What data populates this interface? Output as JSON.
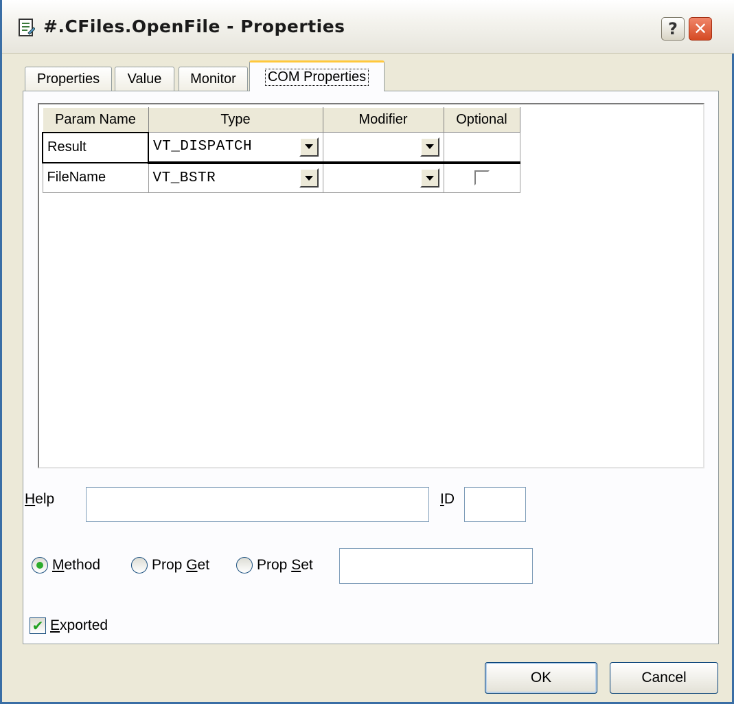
{
  "window": {
    "title": "#.CFiles.OpenFile - Properties",
    "help_glyph": "?",
    "close_glyph": "✕"
  },
  "tabs": [
    {
      "label": "Properties"
    },
    {
      "label": "Value"
    },
    {
      "label": "Monitor"
    },
    {
      "label": "COM Properties",
      "active": true
    }
  ],
  "grid": {
    "columns": [
      "Param Name",
      "Type",
      "Modifier",
      "Optional"
    ],
    "rows": [
      {
        "param": "Result",
        "type": "VT_DISPATCH",
        "modifier": "",
        "optional": null
      },
      {
        "param": "FileName",
        "type": "VT_BSTR",
        "modifier": "",
        "optional": false
      }
    ]
  },
  "help": {
    "label_mnemonic": "H",
    "label_rest": "elp",
    "value": ""
  },
  "id": {
    "label_mnemonic": "I",
    "label_rest": "D",
    "value": ""
  },
  "kind": {
    "method": {
      "pre": "",
      "mnemonic": "M",
      "rest": "ethod",
      "selected": true
    },
    "prop_get": {
      "pre": "Prop ",
      "mnemonic": "G",
      "rest": "et",
      "selected": false
    },
    "prop_set": {
      "pre": "Prop ",
      "mnemonic": "S",
      "rest": "et",
      "selected": false
    },
    "name_value": ""
  },
  "exported": {
    "mnemonic": "E",
    "rest": "xported",
    "checked": true,
    "check_glyph": "✔"
  },
  "buttons": {
    "ok": "OK",
    "cancel": "Cancel"
  }
}
